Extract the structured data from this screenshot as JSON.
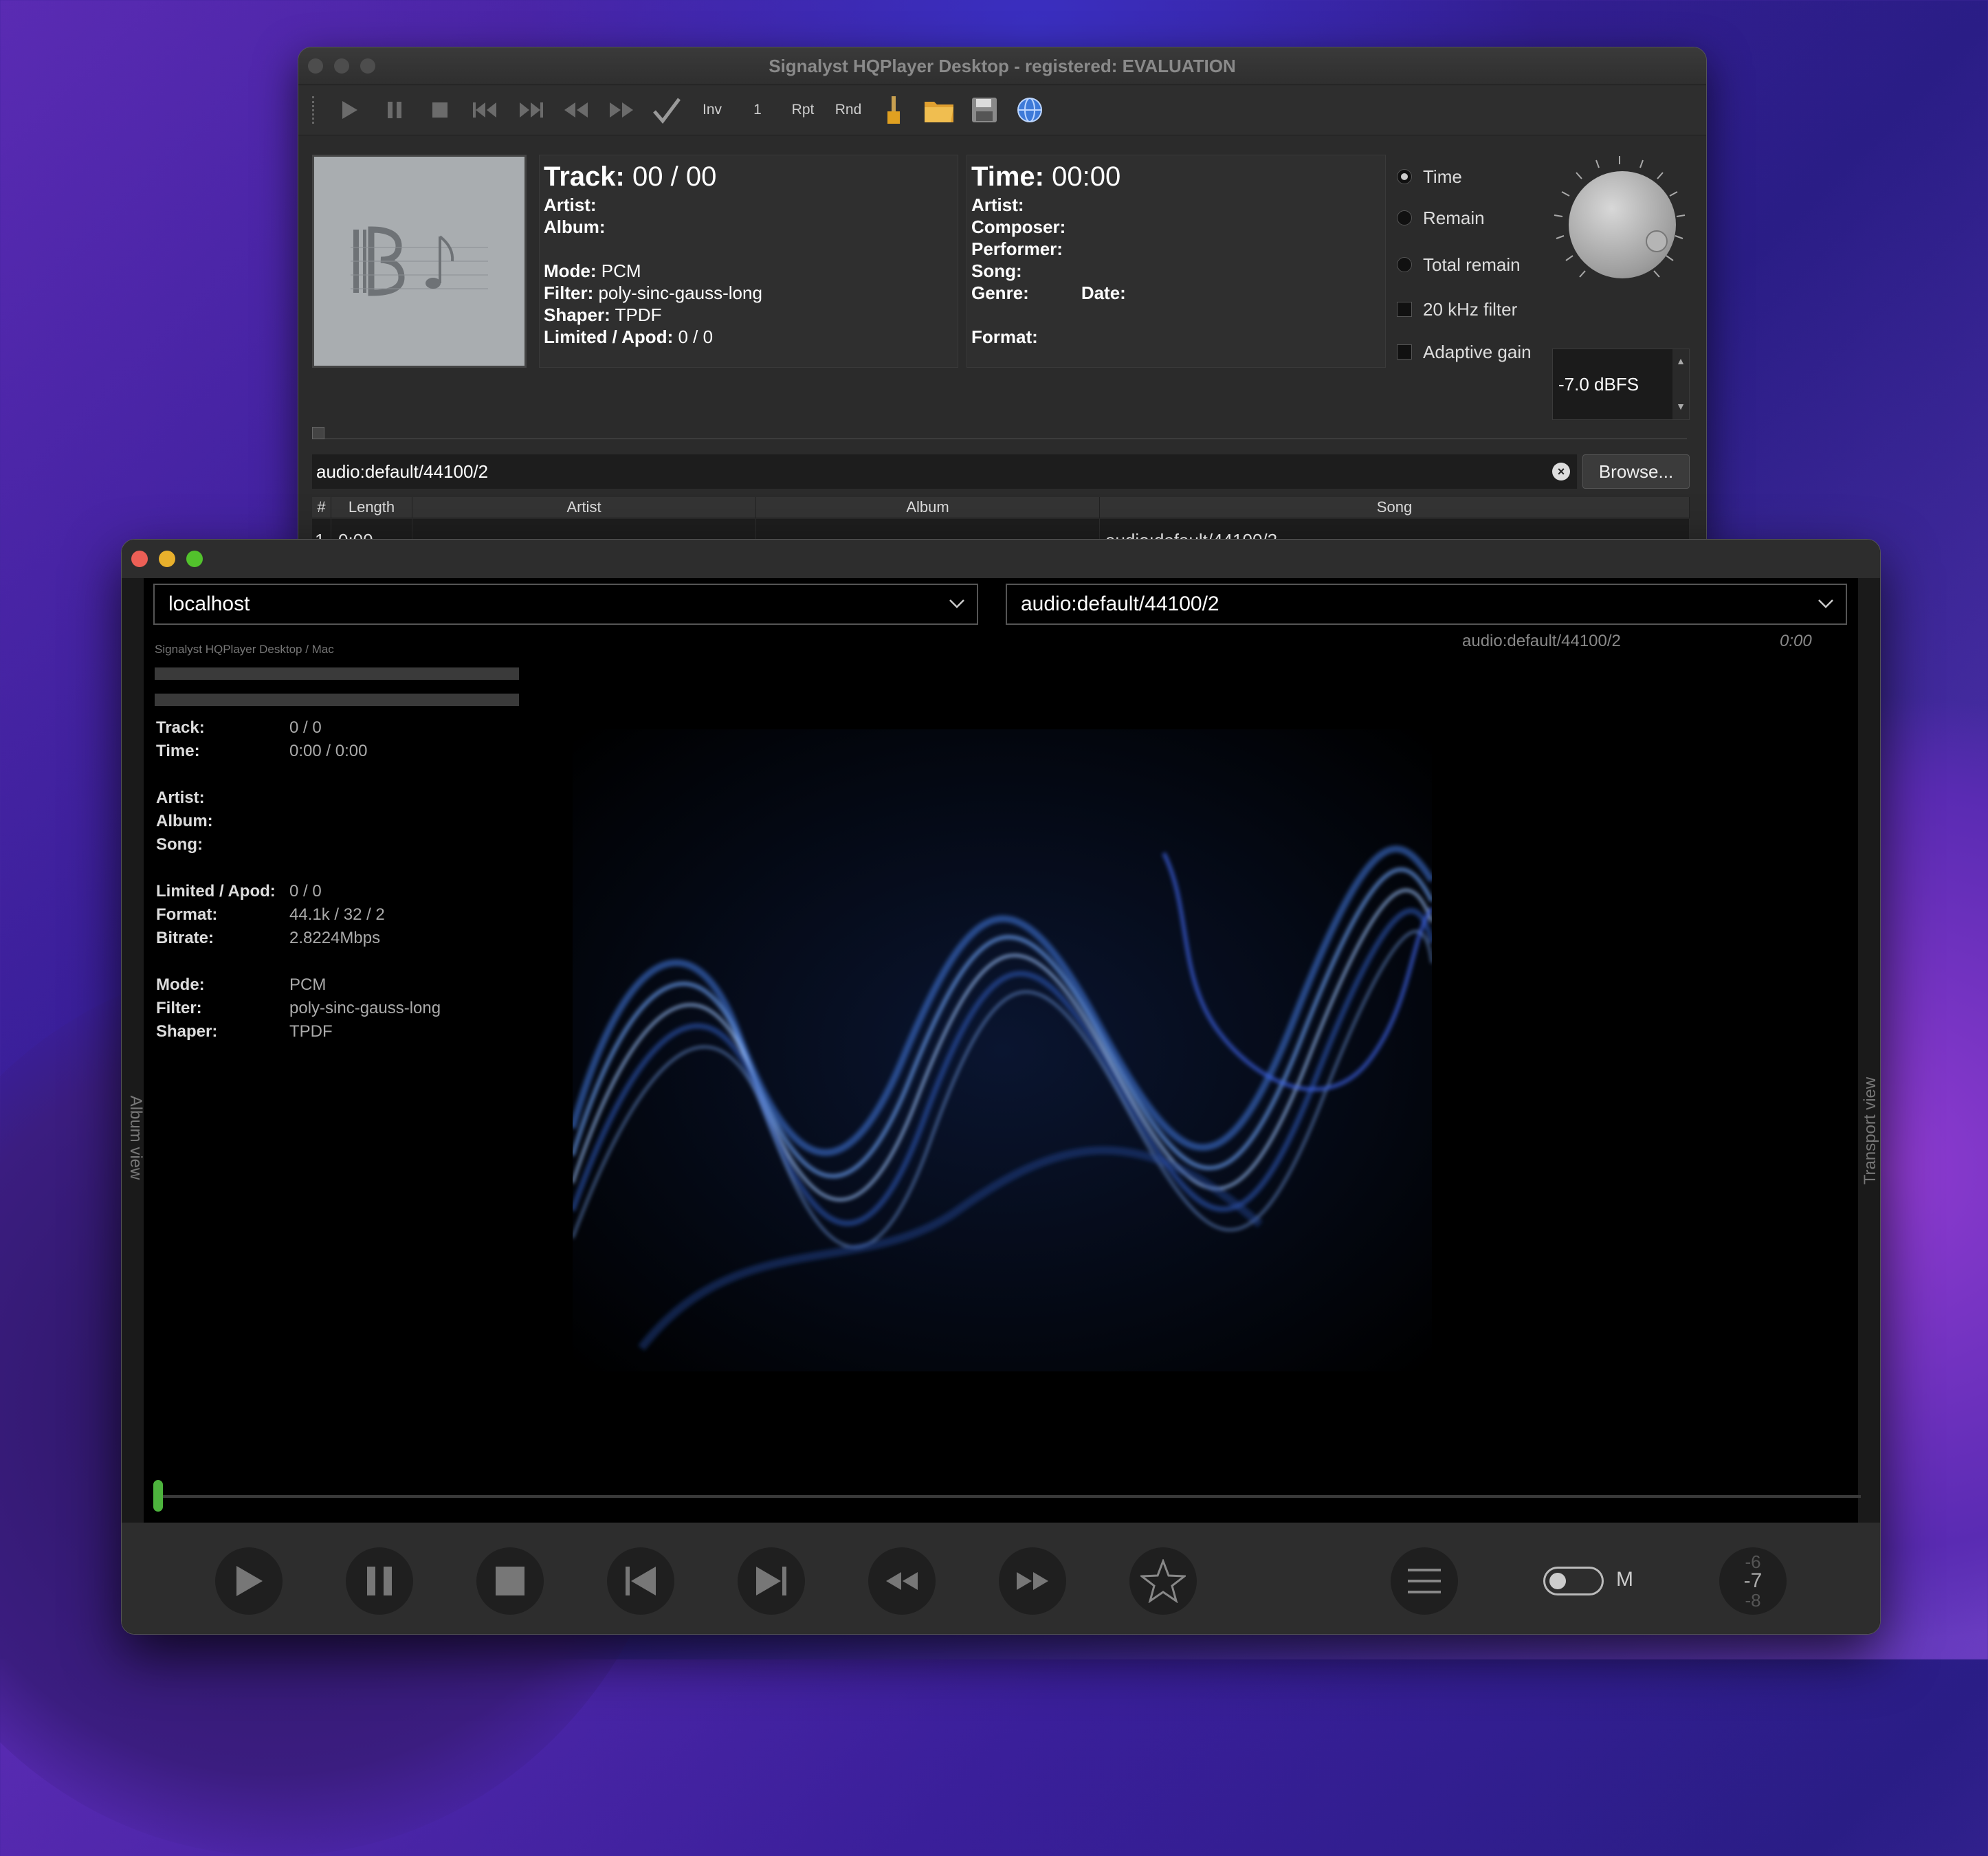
{
  "back_window": {
    "title": "Signalyst HQPlayer Desktop - registered: EVALUATION",
    "toolbar": {
      "play_icon": "play-icon",
      "inv_label": "Inv",
      "one_label": "1",
      "rpt_label": "Rpt",
      "rnd_label": "Rnd"
    },
    "track_panel": {
      "track_label": "Track:",
      "track_value": "00 / 00",
      "artist_label": "Artist:",
      "album_label": "Album:",
      "mode_label": "Mode:",
      "mode_value": "PCM",
      "filter_label": "Filter:",
      "filter_value": "poly-sinc-gauss-long",
      "shaper_label": "Shaper:",
      "shaper_value": "TPDF",
      "limited_label": "Limited / Apod:",
      "limited_value": "0 / 0"
    },
    "time_panel": {
      "time_label": "Time:",
      "time_value": "00:00",
      "artist_label": "Artist:",
      "composer_label": "Composer:",
      "performer_label": "Performer:",
      "song_label": "Song:",
      "genre_label": "Genre:",
      "date_label": "Date:",
      "format_label": "Format:"
    },
    "options": {
      "time_radio": "Time",
      "remain_radio": "Remain",
      "total_remain_radio": "Total remain",
      "filter20k": "20 kHz filter",
      "adaptive_gain": "Adaptive gain",
      "volume_value": "-7.0 dBFS"
    },
    "path": "audio:default/44100/2",
    "browse_label": "Browse...",
    "table": {
      "headers": [
        "#",
        "Length",
        "Artist",
        "Album",
        "Song"
      ],
      "rows": [
        {
          "num": "1",
          "length": "0:00",
          "artist": "",
          "album": "",
          "song": "audio:default/44100/2"
        }
      ]
    }
  },
  "front_window": {
    "host_select": "localhost",
    "device_select": "audio:default/44100/2",
    "mini_title": "Signalyst HQPlayer Desktop / Mac",
    "top_right_device": "audio:default/44100/2",
    "top_right_time": "0:00",
    "left_side_label": "Album view",
    "right_side_label": "Transport view",
    "stats": {
      "track_k": "Track:",
      "track_v": "0 / 0",
      "time_k": "Time:",
      "time_v": "0:00 / 0:00",
      "artist_k": "Artist:",
      "album_k": "Album:",
      "song_k": "Song:",
      "limited_k": "Limited / Apod:",
      "limited_v": "0 / 0",
      "format_k": "Format:",
      "format_v": "44.1k / 32 / 2",
      "bitrate_k": "Bitrate:",
      "bitrate_v": "2.8224Mbps",
      "mode_k": "Mode:",
      "mode_v": "PCM",
      "filter_k": "Filter:",
      "filter_v": "poly-sinc-gauss-long",
      "shaper_k": "Shaper:",
      "shaper_v": "TPDF"
    },
    "transport": {
      "m_label": "M",
      "vol_top": "-6",
      "vol_mid": "-7",
      "vol_bot": "-8"
    }
  },
  "colors": {
    "accent_green": "#4db33d",
    "close_red": "#ec5f56",
    "minimize_yellow": "#e8b02c",
    "zoom_green": "#52c22c"
  }
}
